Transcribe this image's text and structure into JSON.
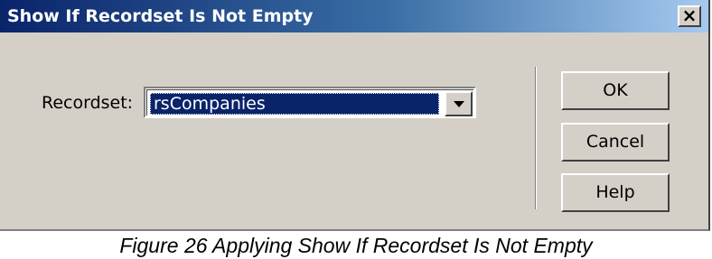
{
  "dialog": {
    "title": "Show If Recordset Is Not Empty",
    "close_glyph": "×",
    "recordset_label": "Recordset:",
    "recordset_value": "rsCompanies",
    "buttons": {
      "ok": "OK",
      "cancel": "Cancel",
      "help": "Help"
    }
  },
  "caption": "Figure 26 Applying Show If Recordset Is Not Empty",
  "icons": {
    "close": "close-icon",
    "dropdown": "chevron-down-icon"
  },
  "colors": {
    "titlebar_start": "#0a246a",
    "titlebar_end": "#a6caf0",
    "dialog_bg": "#d4d0c8",
    "selection_bg": "#0a246a"
  }
}
